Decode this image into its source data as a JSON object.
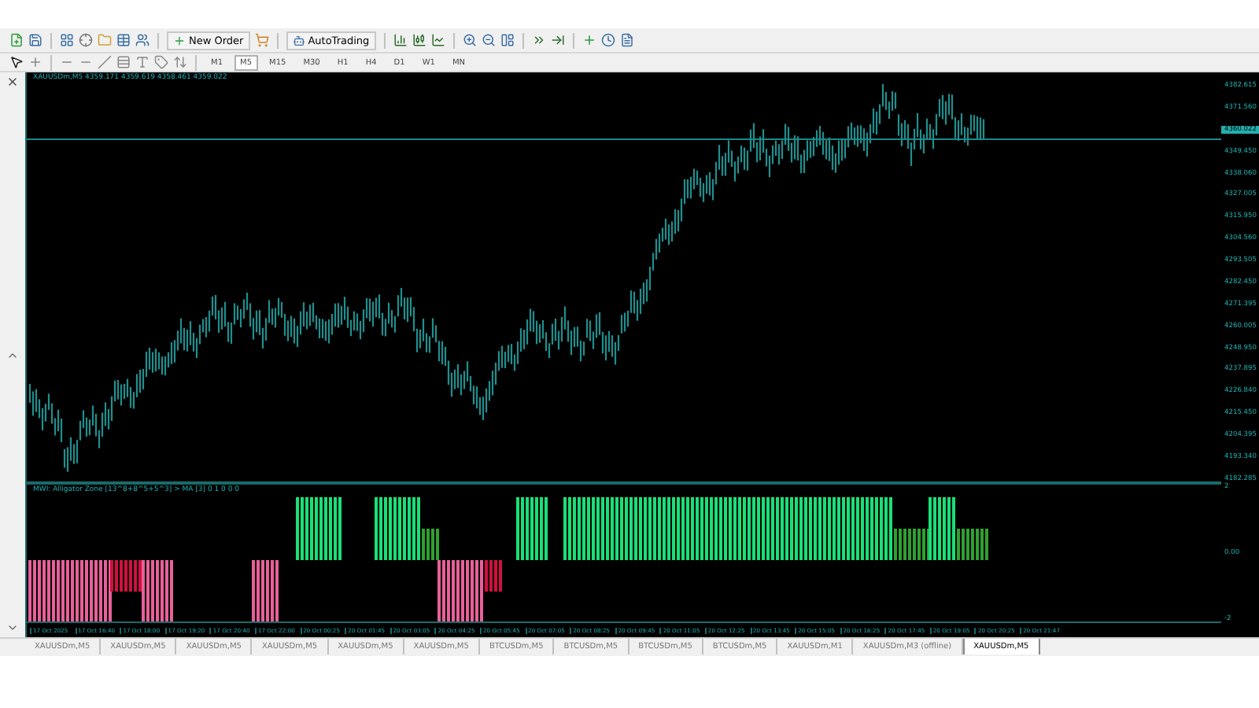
{
  "toolbar": {
    "buttons": [
      {
        "kind": "new-order",
        "label": "New Order"
      },
      {
        "kind": "autotrading",
        "label": "AutoTrading"
      }
    ]
  },
  "timeframes": [
    {
      "label": "M1",
      "selected": false
    },
    {
      "label": "M5",
      "selected": true
    },
    {
      "label": "M15",
      "selected": false
    },
    {
      "label": "M30",
      "selected": false
    },
    {
      "label": "H1",
      "selected": false
    },
    {
      "label": "H4",
      "selected": false
    },
    {
      "label": "D1",
      "selected": false
    },
    {
      "label": "W1",
      "selected": false
    },
    {
      "label": "MN",
      "selected": false
    }
  ],
  "chart": {
    "title": "XAUUSDm,M5  4359.171 4359.619 4358.461 4359.022",
    "price_labels": [
      {
        "text": "4382.615",
        "highlighted": false
      },
      {
        "text": "4371.560",
        "highlighted": false
      },
      {
        "text": "4360.022",
        "highlighted": true
      },
      {
        "text": "4349.450",
        "highlighted": false
      },
      {
        "text": "4338.060",
        "highlighted": false
      },
      {
        "text": "4327.005",
        "highlighted": false
      },
      {
        "text": "4315.950",
        "highlighted": false
      },
      {
        "text": "4304.560",
        "highlighted": false
      },
      {
        "text": "4293.505",
        "highlighted": false
      },
      {
        "text": "4282.450",
        "highlighted": false
      },
      {
        "text": "4271.395",
        "highlighted": false
      },
      {
        "text": "4260.005",
        "highlighted": false
      },
      {
        "text": "4248.950",
        "highlighted": false
      },
      {
        "text": "4237.895",
        "highlighted": false
      },
      {
        "text": "4226.840",
        "highlighted": false
      },
      {
        "text": "4215.450",
        "highlighted": false
      },
      {
        "text": "4204.395",
        "highlighted": false
      },
      {
        "text": "4193.340",
        "highlighted": false
      },
      {
        "text": "4182.285",
        "highlighted": false
      }
    ],
    "indicator": {
      "title": "MWI: Alligator Zone [13^8+8^5+5^3] > MA [3]  0 1 0 0 0",
      "axis_labels": [
        "2",
        "0.00",
        "-2"
      ]
    },
    "time_labels": [
      "17 Oct 2025",
      "17 Oct 16:40",
      "17 Oct 18:00",
      "17 Oct 19:20",
      "17 Oct 20:40",
      "17 Oct 22:00",
      "20 Oct 00:25",
      "20 Oct 01:45",
      "20 Oct 03:05",
      "20 Oct 04:25",
      "20 Oct 05:45",
      "20 Oct 07:05",
      "20 Oct 08:25",
      "20 Oct 09:45",
      "20 Oct 11:05",
      "20 Oct 12:25",
      "20 Oct 13:45",
      "20 Oct 15:05",
      "20 Oct 16:25",
      "20 Oct 17:45",
      "20 Oct 19:05",
      "20 Oct 20:25",
      "20 Oct 21:47"
    ]
  },
  "chart_tabs": [
    {
      "label": "XAUUSDm,M5",
      "selected": false
    },
    {
      "label": "XAUUSDm,M5",
      "selected": false
    },
    {
      "label": "XAUUSDm,M5",
      "selected": false
    },
    {
      "label": "XAUUSDm,M5",
      "selected": false
    },
    {
      "label": "XAUUSDm,M5",
      "selected": false
    },
    {
      "label": "XAUUSDm,M5",
      "selected": false
    },
    {
      "label": "BTCUSDm,M5",
      "selected": false
    },
    {
      "label": "BTCUSDm,M5",
      "selected": false
    },
    {
      "label": "BTCUSDm,M5",
      "selected": false
    },
    {
      "label": "BTCUSDm,M5",
      "selected": false
    },
    {
      "label": "XAUUSDm,M1",
      "selected": false
    },
    {
      "label": "XAUUSDm,M3 (offline)",
      "selected": false
    },
    {
      "label": "XAUUSDm,M5",
      "selected": true
    }
  ]
}
